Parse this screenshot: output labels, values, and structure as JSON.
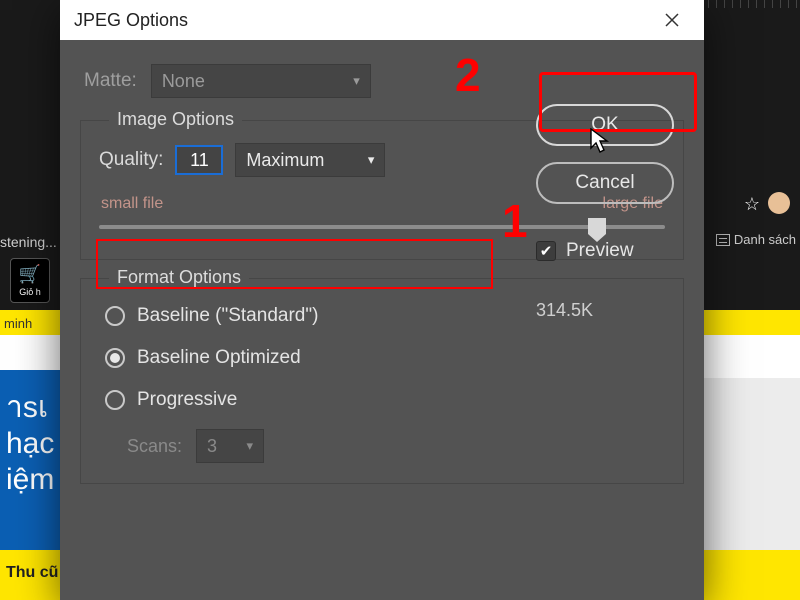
{
  "dialog": {
    "title": "JPEG Options",
    "matte_label": "Matte:",
    "matte_value": "None",
    "image_options_legend": "Image Options",
    "quality_label": "Quality:",
    "quality_value": "11",
    "quality_preset": "Maximum",
    "slider_min_label": "small file",
    "slider_max_label": "large file",
    "format_options_legend": "Format Options",
    "format_standard": "Baseline (\"Standard\")",
    "format_optimized": "Baseline Optimized",
    "format_progressive": "Progressive",
    "scans_label": "Scans:",
    "scans_value": "3",
    "ok_label": "OK",
    "cancel_label": "Cancel",
    "preview_label": "Preview",
    "file_size": "314.5K"
  },
  "annotations": {
    "one": "1",
    "two": "2"
  },
  "background": {
    "listening": "stening...",
    "minh": "minh",
    "gio": "Giỏ h",
    "danh_sach": "Danh sách",
    "blue_a": "าsเ",
    "blue_b": "hạc",
    "blue_c": "iệm",
    "thu_cu": "Thu cũ"
  }
}
